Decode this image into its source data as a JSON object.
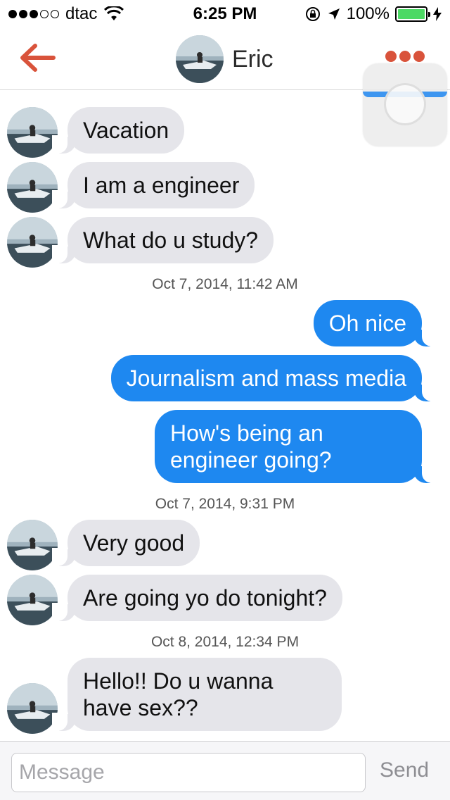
{
  "status_bar": {
    "carrier": "dtac",
    "time": "6:25 PM",
    "battery_text": "100%",
    "battery_level": 1.0,
    "signal_bars_filled": 3,
    "signal_bars_total": 5
  },
  "nav": {
    "title": "Eric",
    "back_icon": "back-arrow-icon",
    "more_icon": "more-dots-icon",
    "accent_color": "#d9533b"
  },
  "messages": [
    {
      "direction": "in",
      "text": "Vacation"
    },
    {
      "direction": "in",
      "text": "I am a engineer"
    },
    {
      "direction": "in",
      "text": "What do u study?"
    },
    {
      "direction": "out",
      "text": "Oh nice"
    },
    {
      "direction": "out",
      "text": "Journalism and mass media"
    },
    {
      "direction": "out",
      "text": "How's being an engineer going?"
    },
    {
      "direction": "in",
      "text": "Very good"
    },
    {
      "direction": "in",
      "text": "Are going yo do tonight?"
    },
    {
      "direction": "in",
      "text": "Hello!! Do u wanna have sex??"
    }
  ],
  "timestamps": [
    "Oct 7, 2014, 11:42 AM",
    "Oct 7, 2014, 9:31 PM",
    "Oct 8, 2014, 12:34 PM"
  ],
  "input": {
    "placeholder": "Message",
    "value": "",
    "send_label": "Send"
  },
  "colors": {
    "outgoing_bubble": "#1e88f0",
    "incoming_bubble": "#e5e5ea",
    "battery": "#4cd964"
  }
}
